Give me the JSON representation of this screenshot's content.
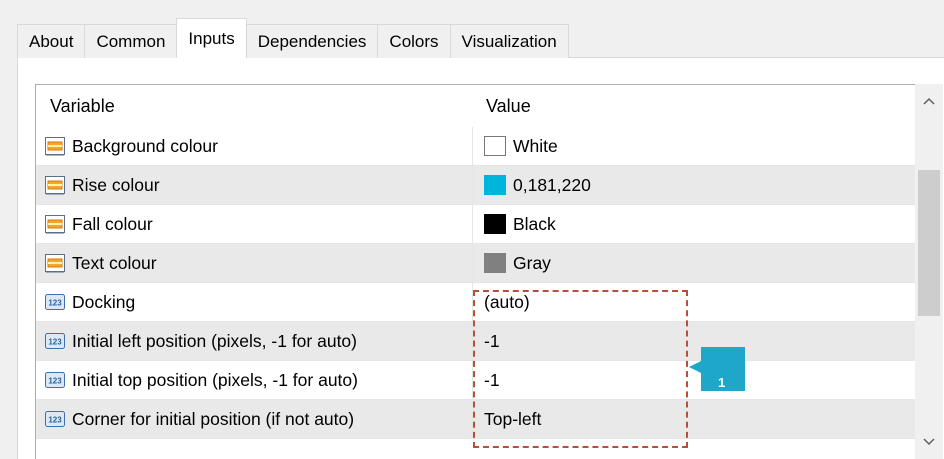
{
  "tabs": [
    {
      "label": "About"
    },
    {
      "label": "Common"
    },
    {
      "label": "Inputs"
    },
    {
      "label": "Dependencies"
    },
    {
      "label": "Colors"
    },
    {
      "label": "Visualization"
    }
  ],
  "active_tab": "Inputs",
  "table": {
    "header": {
      "variable": "Variable",
      "value": "Value"
    },
    "rows": [
      {
        "label": "Background colour",
        "value": "White",
        "icon": "color-param-icon",
        "swatch": "#ffffff"
      },
      {
        "label": "Rise colour",
        "value": "0,181,220",
        "icon": "color-param-icon",
        "swatch": "#00b5dc"
      },
      {
        "label": "Fall colour",
        "value": "Black",
        "icon": "color-param-icon",
        "swatch": "#000000"
      },
      {
        "label": "Text colour",
        "value": "Gray",
        "icon": "color-param-icon",
        "swatch": "#808080"
      },
      {
        "label": "Docking",
        "value": "(auto)",
        "icon": "numeric-param-icon"
      },
      {
        "label": "Initial left position (pixels, -1 for auto)",
        "value": "-1",
        "icon": "numeric-param-icon"
      },
      {
        "label": "Initial top position (pixels, -1 for auto)",
        "value": "-1",
        "icon": "numeric-param-icon"
      },
      {
        "label": "Corner for initial position (if not auto)",
        "value": "Top-left",
        "icon": "numeric-param-icon"
      }
    ]
  },
  "annotation": {
    "number": "1",
    "color": "#1ea7c9",
    "border_color": "#b5503a"
  }
}
